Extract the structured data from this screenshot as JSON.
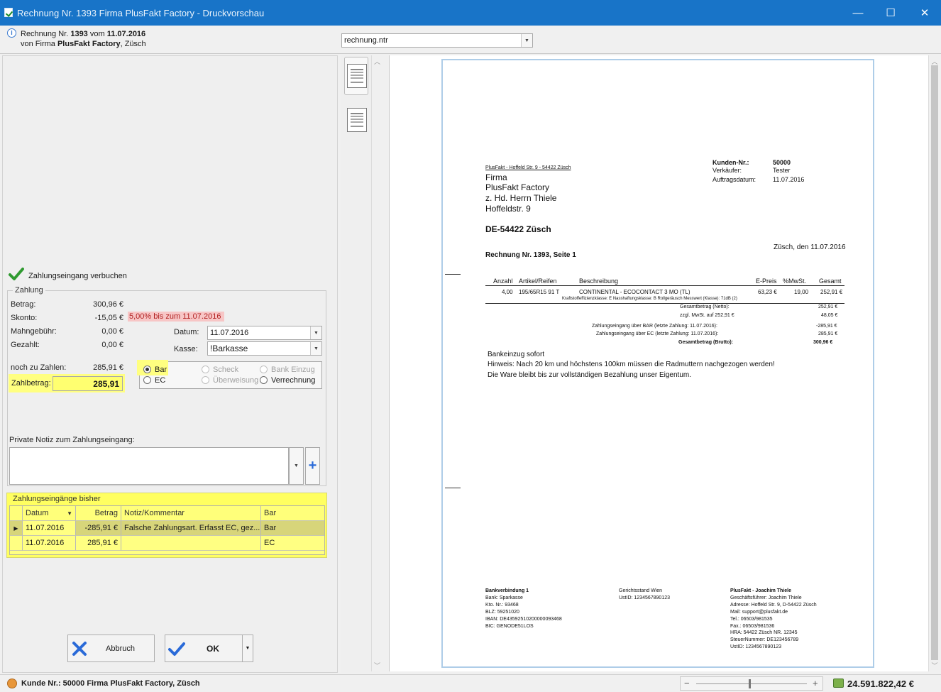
{
  "window": {
    "title": "Rechnung Nr. 1393 Firma PlusFakt Factory - Druckvorschau",
    "minimize": "—",
    "maximize": "☐",
    "close": "✕"
  },
  "header": {
    "line1_prefix": "Rechnung Nr. ",
    "line1_number": "1393",
    "line1_mid": " vom ",
    "line1_date": "11.07.2016",
    "line2_prefix": "von Firma ",
    "line2_company": "PlusFakt Factory",
    "line2_suffix": ", Züsch",
    "template": "rechnung.ntr"
  },
  "payment": {
    "book_label": "Zahlungseingang verbuchen",
    "group_title": "Zahlung",
    "betrag_label": "Betrag:",
    "betrag_value": "300,96 €",
    "skonto_label": "Skonto:",
    "skonto_value": "-15,05 €",
    "skonto_badge": "5,00% bis zum 11.07.2016",
    "mahn_label": "Mahngebühr:",
    "mahn_value": "0,00 €",
    "gezahlt_label": "Gezahlt:",
    "gezahlt_value": "0,00 €",
    "datum_label": "Datum:",
    "datum_value": "11.07.2016",
    "kasse_label": "Kasse:",
    "kasse_value": "!Barkasse",
    "noch_label": "noch zu Zahlen:",
    "noch_value": "285,91 €",
    "zahlbetrag_label": "Zahlbetrag:",
    "zahlbetrag_value": "285,91",
    "methods": {
      "bar": "Bar",
      "ec": "EC",
      "scheck": "Scheck",
      "ueberweisung": "Überweisung",
      "bank_einzug": "Bank Einzug",
      "verrechnung": "Verrechnung"
    },
    "notiz_label": "Private Notiz zum Zahlungseingang:"
  },
  "history": {
    "title": "Zahlungseingänge bisher",
    "columns": [
      "Datum",
      "Betrag",
      "Notiz/Kommentar",
      "Bar"
    ],
    "rows": [
      {
        "datum": "11.07.2016",
        "betrag": "-285,91 €",
        "notiz": "Falsche Zahlungsart. Erfasst EC, gez...",
        "art": "Bar"
      },
      {
        "datum": "11.07.2016",
        "betrag": "285,91 €",
        "notiz": "",
        "art": "EC"
      }
    ]
  },
  "buttons": {
    "abbruch": "Abbruch",
    "ok": "OK"
  },
  "invoice": {
    "sender_line": "PlusFakt - Hoffeld Str. 9 - 54422 Züsch",
    "recipient": [
      "Firma",
      "PlusFakt Factory",
      "z. Hd. Herrn Thiele",
      "Hoffeldstr. 9"
    ],
    "recipient_city": "DE-54422 Züsch",
    "meta_labels": [
      "Kunden-Nr.:",
      "Verkäufer:",
      "Auftragsdatum:"
    ],
    "meta_values": [
      "50000",
      "Tester",
      "11.07.2016"
    ],
    "place_date": "Züsch, den 11.07.2016",
    "heading": "Rechnung Nr. 1393, Seite 1",
    "table_head": [
      "Anzahl",
      "Artikel/Reifen",
      "Beschreibung",
      "E-Preis",
      "%MwSt.",
      "Gesamt"
    ],
    "item": {
      "anzahl": "4,00",
      "artikel": "195/65R15 91 T",
      "beschreibung": "CONTINENTAL - ECOCONTACT 3 MO (TL)",
      "epreis": "63,23 €",
      "mwst": "19,00",
      "gesamt": "252,91 €",
      "detail": "Kraftstoffeffizienzklasse: E   Nasshaftungsklasse: B   Rollgeräusch Messwert (Klasse): 71dB (2)"
    },
    "totals": [
      {
        "label": "Gesamtbetrag (Netto):",
        "value": "252,91 €"
      },
      {
        "label": "zzgl.  MwSt. auf      252,91 €",
        "value": "48,05 €"
      },
      {
        "label": "Zahlungseingang über BAR (letzte Zahlung: 11.07.2016):",
        "value": "-285,91 €"
      },
      {
        "label": "Zahlungseingang über EC (letzte Zahlung: 11.07.2016):",
        "value": "285,91 €"
      },
      {
        "label": "Gesamtbetrag (Brutto):",
        "value": "300,96  €"
      }
    ],
    "notes": [
      "Bankeinzug sofort",
      "Hinweis: Nach 20 km und höchstens 100km müssen die Radmuttern nachgezogen werden!",
      "Die Ware bleibt bis zur vollständigen Bezahlung unser Eigentum."
    ],
    "footer_bank": [
      "Bankverbindung 1",
      "Bank: Sparkasse",
      "Kto. Nr.: 93468",
      "BLZ: 59251020",
      "IBAN: DE43592510200000093468",
      "BIC: GENODE51LOS"
    ],
    "footer_court": [
      "Gerichtsstand Wien",
      "UstID: 1234567890123"
    ],
    "footer_company": [
      "PlusFakt - Joachim Thiele",
      "Geschäftsführer: Joachim Thiele",
      "Adresse: Hoffeld Str. 9, D-54422 Züsch",
      "Mail: support@plusfakt.de",
      "Tel.: 06503/981535",
      "Fax.: 06503/981536",
      "HRA: 54422 Züsch NR. 12345",
      "SteuerNummer: DE123456789",
      "UstID: 1234567890123"
    ]
  },
  "status": {
    "customer": "Kunde  Nr.: 50000 Firma  PlusFakt Factory, Züsch",
    "total": "24.591.822,42 €"
  },
  "colors": {
    "titlebar": "#1874c8",
    "highlight": "#ffff60",
    "skonto_bg": "#f7c6c6",
    "ok_check": "#2a6ad8",
    "cancel_x": "#2a6ad8"
  }
}
